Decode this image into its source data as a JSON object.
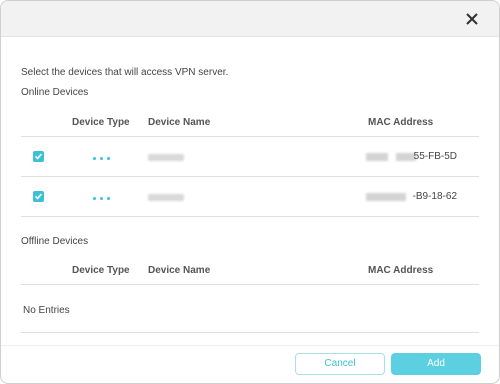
{
  "dialog": {
    "intro": "Select the devices that will access VPN server.",
    "online_title": "Online Devices",
    "offline_title": "Offline Devices",
    "close_icon": "close-icon"
  },
  "columns": {
    "type": "Device Type",
    "name": "Device Name",
    "mac": "MAC Address"
  },
  "online_devices": [
    {
      "checked": true,
      "type_icon": "more-dots-icon",
      "mac_visible": "55-FB-5D"
    },
    {
      "checked": true,
      "type_icon": "more-dots-icon",
      "mac_visible": "-B9-18-62"
    }
  ],
  "offline_devices": {
    "empty_text": "No Entries"
  },
  "footer": {
    "cancel_label": "Cancel",
    "add_label": "Add"
  },
  "colors": {
    "accent": "#3cc0d4",
    "add_button": "#5ccfe0"
  }
}
